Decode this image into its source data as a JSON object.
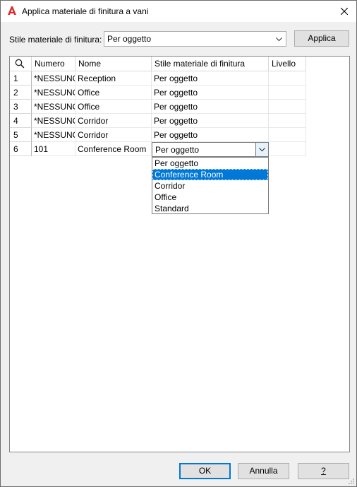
{
  "window": {
    "title": "Applica materiale di finitura a vani"
  },
  "toolbar": {
    "style_label": "Stile materiale di finitura:",
    "style_value": "Per oggetto",
    "apply_label": "Applica"
  },
  "table": {
    "columns": [
      "Numero",
      "Nome",
      "Stile materiale di finitura",
      "Livello"
    ],
    "rows": [
      {
        "idx": "1",
        "numero": "*NESSUNO*",
        "nome": "Reception",
        "stile": "Per oggetto",
        "livello": ""
      },
      {
        "idx": "2",
        "numero": "*NESSUNO*",
        "nome": "Office",
        "stile": "Per oggetto",
        "livello": ""
      },
      {
        "idx": "3",
        "numero": "*NESSUNO*",
        "nome": "Office",
        "stile": "Per oggetto",
        "livello": ""
      },
      {
        "idx": "4",
        "numero": "*NESSUNO*",
        "nome": "Corridor",
        "stile": "Per oggetto",
        "livello": ""
      },
      {
        "idx": "5",
        "numero": "*NESSUNO*",
        "nome": "Corridor",
        "stile": "Per oggetto",
        "livello": ""
      },
      {
        "idx": "6",
        "numero": "101",
        "nome": "Conference Room",
        "stile": "Per oggetto",
        "livello": ""
      }
    ]
  },
  "dropdown": {
    "current": "Per oggetto",
    "options": [
      "Per oggetto",
      "Conference Room",
      "Corridor",
      "Office",
      "Standard"
    ],
    "selected_index": 1
  },
  "footer": {
    "ok_label": "OK",
    "cancel_label": "Annulla",
    "help_label": "?"
  },
  "colors": {
    "selection": "#0078d7",
    "brand": "#e32b2b"
  }
}
